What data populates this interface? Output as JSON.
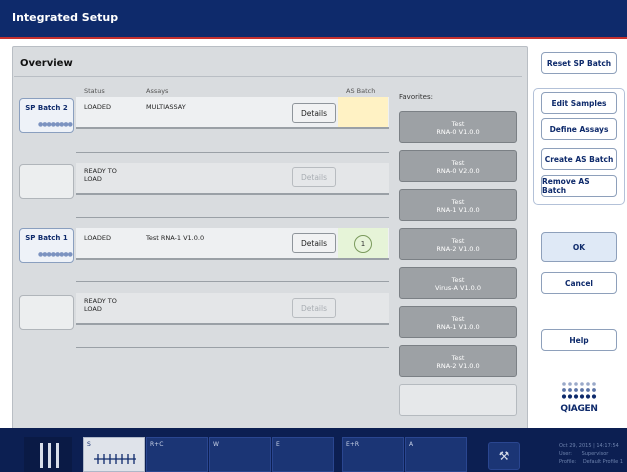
{
  "window_title": "Integrated Setup",
  "overview_label": "Overview",
  "columns": {
    "status": "Status",
    "assays": "Assays",
    "as_batch": "AS Batch"
  },
  "favorites_label": "Favorites:",
  "details_label": "Details",
  "rows": [
    {
      "batch": "SP Batch 2",
      "status": "LOADED",
      "assay": "MULTIASSAY",
      "details_enabled": true,
      "as_batch": ""
    },
    {
      "batch": "",
      "status": "READY TO LOAD",
      "assay": "",
      "details_enabled": false,
      "as_batch": ""
    },
    {
      "batch": "SP Batch 1",
      "status": "LOADED",
      "assay": "Test RNA-1 V1.0.0",
      "details_enabled": true,
      "as_batch": "1"
    },
    {
      "batch": "",
      "status": "READY TO LOAD",
      "assay": "",
      "details_enabled": false,
      "as_batch": ""
    }
  ],
  "favorites": [
    {
      "line1": "Test",
      "line2": "RNA-0 V1.0.0"
    },
    {
      "line1": "Test",
      "line2": "RNA-0 V2.0.0"
    },
    {
      "line1": "Test",
      "line2": "RNA-1 V1.0.0"
    },
    {
      "line1": "Test",
      "line2": "RNA-2 V1.0.0"
    },
    {
      "line1": "Test",
      "line2": "Virus-A V1.0.0"
    },
    {
      "line1": "Test",
      "line2": "RNA-1 V1.0.0"
    },
    {
      "line1": "Test",
      "line2": "RNA-2 V1.0.0"
    }
  ],
  "side_buttons": {
    "reset": "Reset SP Batch",
    "edit": "Edit Samples",
    "define": "Define Assays",
    "create": "Create AS Batch",
    "remove": "Remove AS Batch",
    "ok": "OK",
    "cancel": "Cancel",
    "help": "Help"
  },
  "brand": "QIAGEN",
  "footer": {
    "slots": [
      "S",
      "R+C",
      "W",
      "E",
      "E+R",
      "A"
    ],
    "datetime": "Oct 29, 2015 | 14:17:54",
    "user_label": "User:",
    "user": "Supervisor",
    "profile_label": "Profile:",
    "profile": "Default Profile 1"
  },
  "colors": {
    "accent": "#0e2a6b",
    "red_line": "#c5312e",
    "as_batch_yellow": "#fff2c4",
    "as_batch_green": "#e6f4d8"
  }
}
